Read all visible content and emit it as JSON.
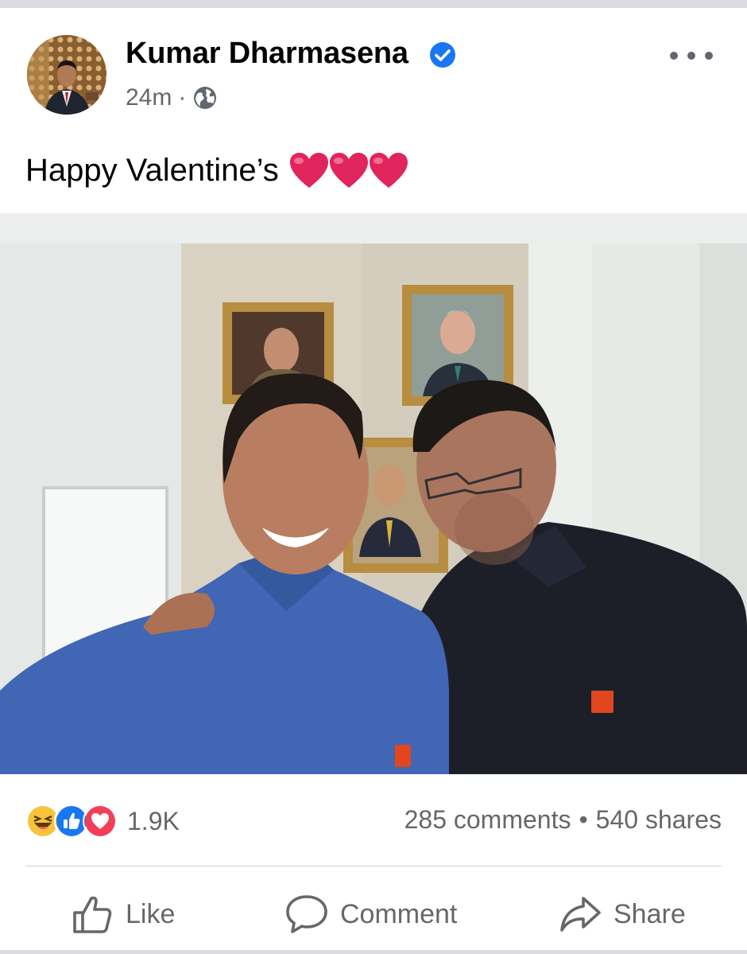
{
  "post": {
    "author": "Kumar Dharmasena",
    "time": "24m",
    "meta_separator": "·",
    "text": "Happy Valentine’s",
    "text_emoji_count": 3
  },
  "engagement": {
    "reaction_count": "1.9K",
    "comments": "285 comments",
    "separator": "•",
    "shares": "540 shares",
    "reactions": [
      "haha-icon",
      "like-reaction-icon",
      "love-reaction-icon"
    ]
  },
  "actions": {
    "like_label": "Like",
    "comment_label": "Comment",
    "share_label": "Share"
  },
  "colors": {
    "verified_blue": "#1877f2",
    "secondary_text": "#65676b",
    "heart_red": "#e0245e"
  }
}
